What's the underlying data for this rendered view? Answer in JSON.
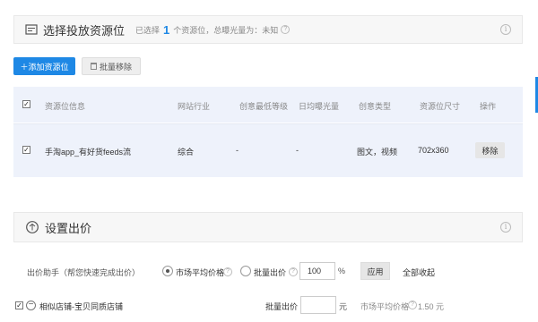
{
  "section1": {
    "title": "选择投放资源位",
    "selected_prefix": "已选择",
    "selected_count": "1",
    "selected_suffix": "个资源位，总曝光量为：未知"
  },
  "toolbar": {
    "add_label": "＋添加资源位",
    "remove_label": "批量移除"
  },
  "table": {
    "headers": [
      "资源位信息",
      "网站行业",
      "创意最低等级",
      "日均曝光量",
      "创意类型",
      "资源位尺寸",
      "操作"
    ],
    "rows": [
      {
        "name": "手淘app_有好货feeds流",
        "industry": "综合",
        "min_level": "-",
        "daily": "-",
        "creative_type": "图文，视频",
        "size": "702x360",
        "action": "移除"
      }
    ]
  },
  "section2": {
    "title": "设置出价"
  },
  "bidding": {
    "helper_label": "出价助手（帮您快速完成出价）",
    "option_market": "市场平均价格",
    "option_batch": "批量出价",
    "batch_value": "100",
    "percent": "%",
    "apply_label": "应用",
    "collapse_label": "全部收起"
  },
  "item": {
    "name": "相似店铺-宝贝同质店铺",
    "batch_label": "批量出价",
    "unit": "元",
    "market_label": "市场平均价格",
    "market_value": "1.50 元"
  },
  "colors": {
    "accent": "#1e88e5"
  }
}
